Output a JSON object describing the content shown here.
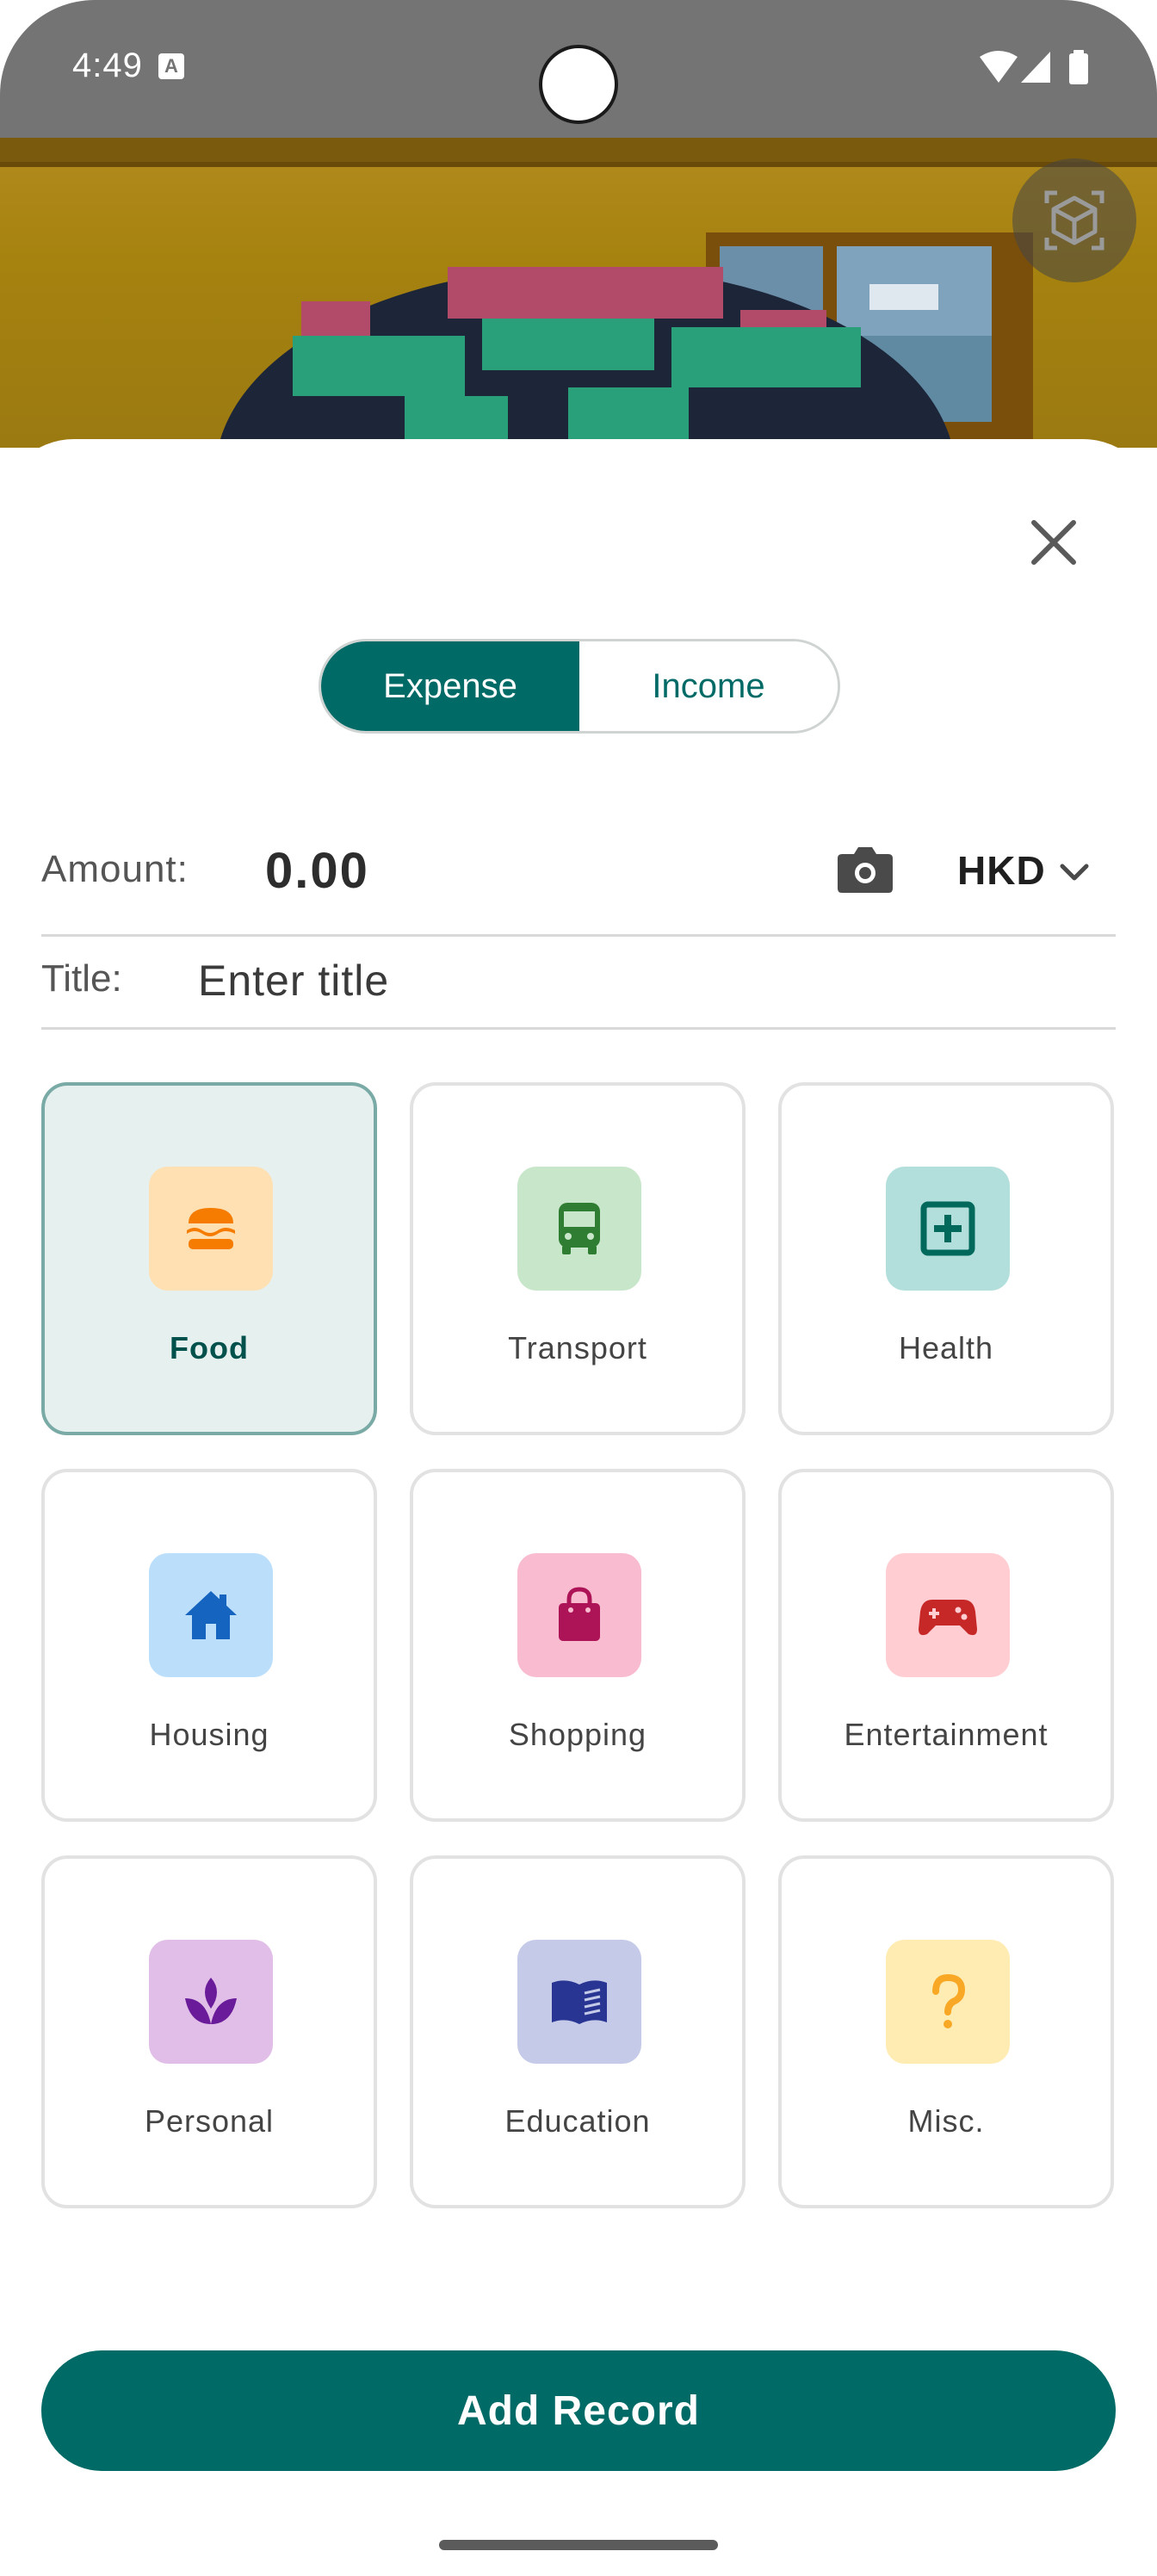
{
  "status_bar": {
    "time": "4:49"
  },
  "sheet": {
    "close_icon": "close-icon",
    "segments": [
      {
        "label": "Expense",
        "selected": true
      },
      {
        "label": "Income",
        "selected": false
      }
    ]
  },
  "form": {
    "amount_label": "Amount:",
    "amount_value": "0.00",
    "currency": "HKD",
    "title_label": "Title:",
    "title_placeholder": "Enter title"
  },
  "categories": [
    {
      "label": "Food",
      "icon": "burger-icon",
      "icon_bg": "#ffe0b3",
      "icon_color": "#f57c00",
      "selected": true
    },
    {
      "label": "Transport",
      "icon": "bus-icon",
      "icon_bg": "#c8e6c9",
      "icon_color": "#2e7d32",
      "selected": false
    },
    {
      "label": "Health",
      "icon": "medical-icon",
      "icon_bg": "#b2dfdb",
      "icon_color": "#00695c",
      "selected": false
    },
    {
      "label": "Housing",
      "icon": "house-icon",
      "icon_bg": "#bbdefb",
      "icon_color": "#1565c0",
      "selected": false
    },
    {
      "label": "Shopping",
      "icon": "shopping-bag-icon",
      "icon_bg": "#f8bbd0",
      "icon_color": "#ad1457",
      "selected": false
    },
    {
      "label": "Entertainment",
      "icon": "gamepad-icon",
      "icon_bg": "#ffcdd2",
      "icon_color": "#c62828",
      "selected": false
    },
    {
      "label": "Personal",
      "icon": "spa-icon",
      "icon_bg": "#e1bee7",
      "icon_color": "#6a1b9a",
      "selected": false
    },
    {
      "label": "Education",
      "icon": "book-icon",
      "icon_bg": "#c5cae9",
      "icon_color": "#283593",
      "selected": false
    },
    {
      "label": "Misc.",
      "icon": "question-icon",
      "icon_bg": "#ffecb3",
      "icon_color": "#f9a825",
      "selected": false
    }
  ],
  "actions": {
    "add_record": "Add Record"
  },
  "colors": {
    "primary": "#006a66",
    "selected_card_bg": "#e6f0ef"
  }
}
